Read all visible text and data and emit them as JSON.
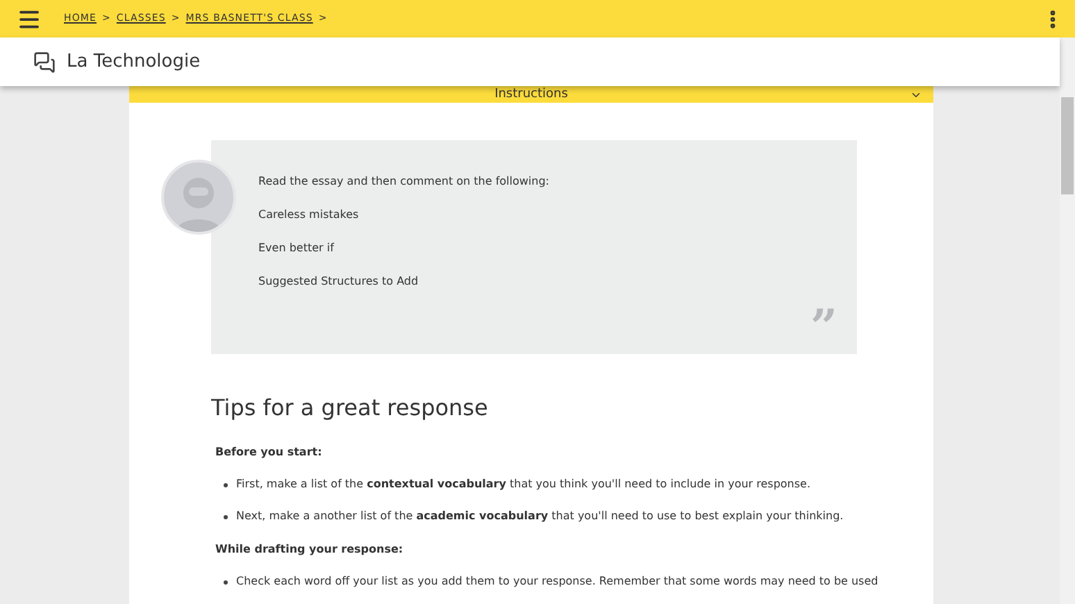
{
  "breadcrumb": [
    "HOME",
    "CLASSES",
    "MRS BASNETT'S CLASS"
  ],
  "breadcrumb_separator": ">",
  "title": "La Technologie",
  "instructions": {
    "heading": "Instructions",
    "expanded": true,
    "lines": [
      "Read the essay and then comment on the following:",
      "Careless mistakes",
      "Even better if",
      "Suggested Structures to Add"
    ],
    "quote_mark": "”"
  },
  "tips": {
    "heading": "Tips for a great response",
    "sections": [
      {
        "heading": "Before you start:",
        "items": [
          "First, make a list of the **contextual vocabulary** that you think you'll need to include in your response.",
          "Next, make a another list of the **academic vocabulary** that you'll need to use to best explain your thinking."
        ]
      },
      {
        "heading": "While drafting your response:",
        "items": [
          "Check each word off your list as you add them to your response. Remember that some words may need to be used"
        ]
      }
    ]
  }
}
